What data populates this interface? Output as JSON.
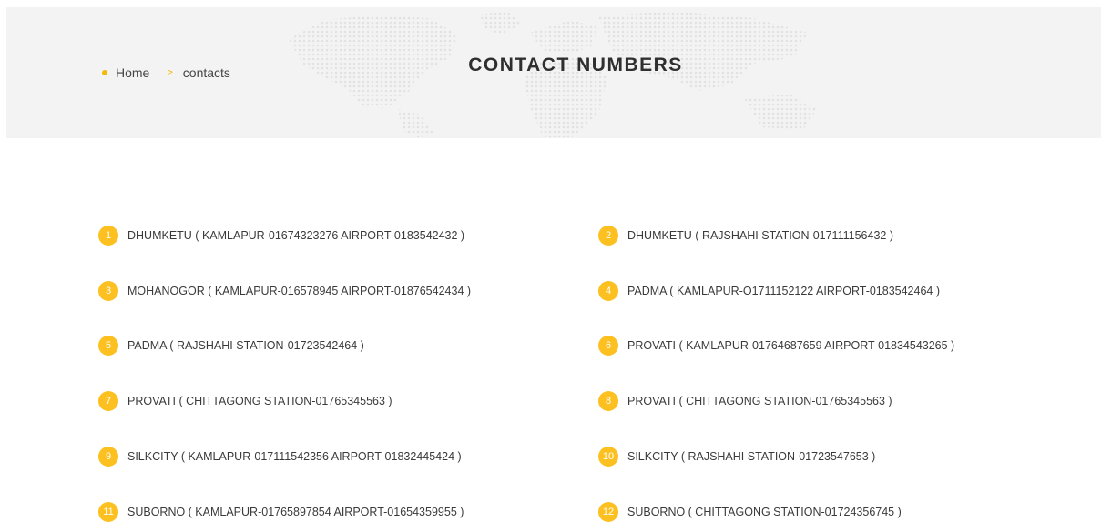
{
  "breadcrumb": {
    "home": "Home",
    "separator": ">",
    "current": "contacts"
  },
  "page_title": "CONTACT NUMBERS",
  "colors": {
    "accent": "#fdc021",
    "banner_bg": "#f3f3f3",
    "text": "#3a3a3a"
  },
  "contacts": [
    {
      "num": "1",
      "text": "DHUMKETU ( KAMLAPUR-01674323276 AIRPORT-0183542432 )"
    },
    {
      "num": "2",
      "text": "DHUMKETU ( RAJSHAHI STATION-017111156432 )"
    },
    {
      "num": "3",
      "text": "MOHANOGOR ( KAMLAPUR-016578945 AIRPORT-01876542434 )"
    },
    {
      "num": "4",
      "text": "PADMA ( KAMLAPUR-O1711152122 AIRPORT-0183542464 )"
    },
    {
      "num": "5",
      "text": "PADMA ( RAJSHAHI STATION-01723542464 )"
    },
    {
      "num": "6",
      "text": "PROVATI ( KAMLAPUR-01764687659 AIRPORT-01834543265 )"
    },
    {
      "num": "7",
      "text": "PROVATI ( CHITTAGONG STATION-01765345563 )"
    },
    {
      "num": "8",
      "text": "PROVATI ( CHITTAGONG STATION-01765345563 )"
    },
    {
      "num": "9",
      "text": "SILKCITY ( KAMLAPUR-017111542356 AIRPORT-01832445424 )"
    },
    {
      "num": "10",
      "text": "SILKCITY ( RAJSHAHI STATION-01723547653 )"
    },
    {
      "num": "11",
      "text": "SUBORNO ( KAMLAPUR-01765897854 AIRPORT-01654359955 )"
    },
    {
      "num": "12",
      "text": "SUBORNO ( CHITTAGONG STATION-01724356745 )"
    }
  ]
}
